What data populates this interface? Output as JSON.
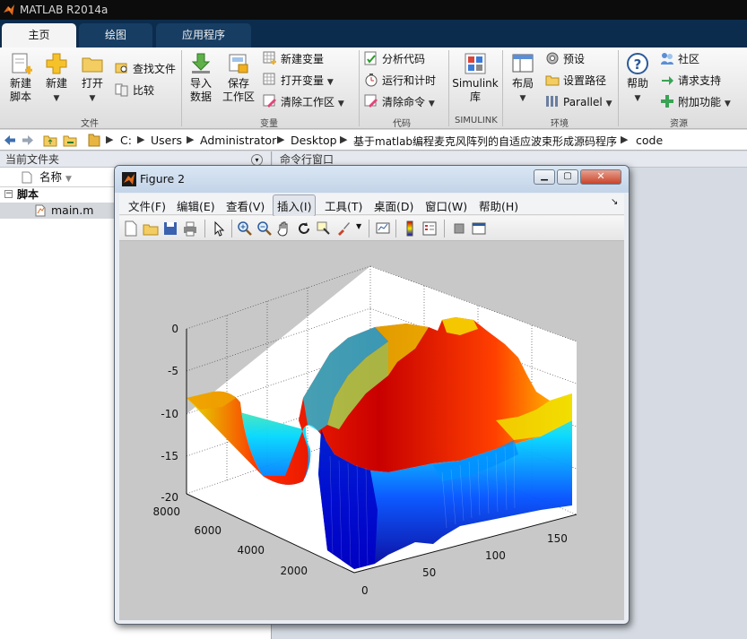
{
  "window": {
    "title": "MATLAB R2014a"
  },
  "tabs": [
    {
      "label": "主页"
    },
    {
      "label": "绘图"
    },
    {
      "label": "应用程序"
    }
  ],
  "ribbon": {
    "new_script": {
      "line1": "新建",
      "line2": "脚本"
    },
    "new": "新建",
    "open": "打开",
    "find_files": "查找文件",
    "compare": "比较",
    "import_data": {
      "line1": "导入",
      "line2": "数据"
    },
    "save_workspace": {
      "line1": "保存",
      "line2": "工作区"
    },
    "new_variable": "新建变量",
    "open_variable": "打开变量",
    "clear_workspace": "清除工作区",
    "analyze_code": "分析代码",
    "run_and_time": "运行和计时",
    "clear_commands": "清除命令",
    "simulink": {
      "line1": "Simulink",
      "line2": "库"
    },
    "layout": "布局",
    "preferences": "预设",
    "set_path": "设置路径",
    "parallel": "Parallel",
    "help": "帮助",
    "community": "社区",
    "request_support": "请求支持",
    "add_ons": "附加功能",
    "groups": {
      "file": "文件",
      "variable": "变量",
      "code": "代码",
      "simulink": "SIMULINK",
      "environment": "环境",
      "resources": "资源"
    }
  },
  "address": {
    "segments": [
      "C:",
      "Users",
      "Administrator",
      "Desktop",
      "基于matlab编程麦克风阵列的自适应波束形成源码程序",
      "code"
    ]
  },
  "current_folder": {
    "title": "当前文件夹",
    "column": "名称",
    "group": "脚本",
    "files": [
      {
        "name": "main.m"
      }
    ]
  },
  "command_window": {
    "title": "命令行窗口"
  },
  "figure": {
    "title": "Figure 2",
    "menu": [
      "文件(F)",
      "编辑(E)",
      "查看(V)",
      "插入(I)",
      "工具(T)",
      "桌面(D)",
      "窗口(W)",
      "帮助(H)"
    ],
    "zaxis_ticks": [
      "0",
      "-5",
      "-10",
      "-15",
      "-20"
    ],
    "yaxis_ticks": [
      "8000",
      "6000",
      "4000",
      "2000"
    ],
    "xaxis_ticks": [
      "0",
      "50",
      "100",
      "150"
    ]
  },
  "colors": {
    "tab_bar": "#0c2c4d",
    "ribbon_bg": "#f0f0f0",
    "figure_bg": "#c8c8c8",
    "plot_bg": "#ffffff"
  }
}
